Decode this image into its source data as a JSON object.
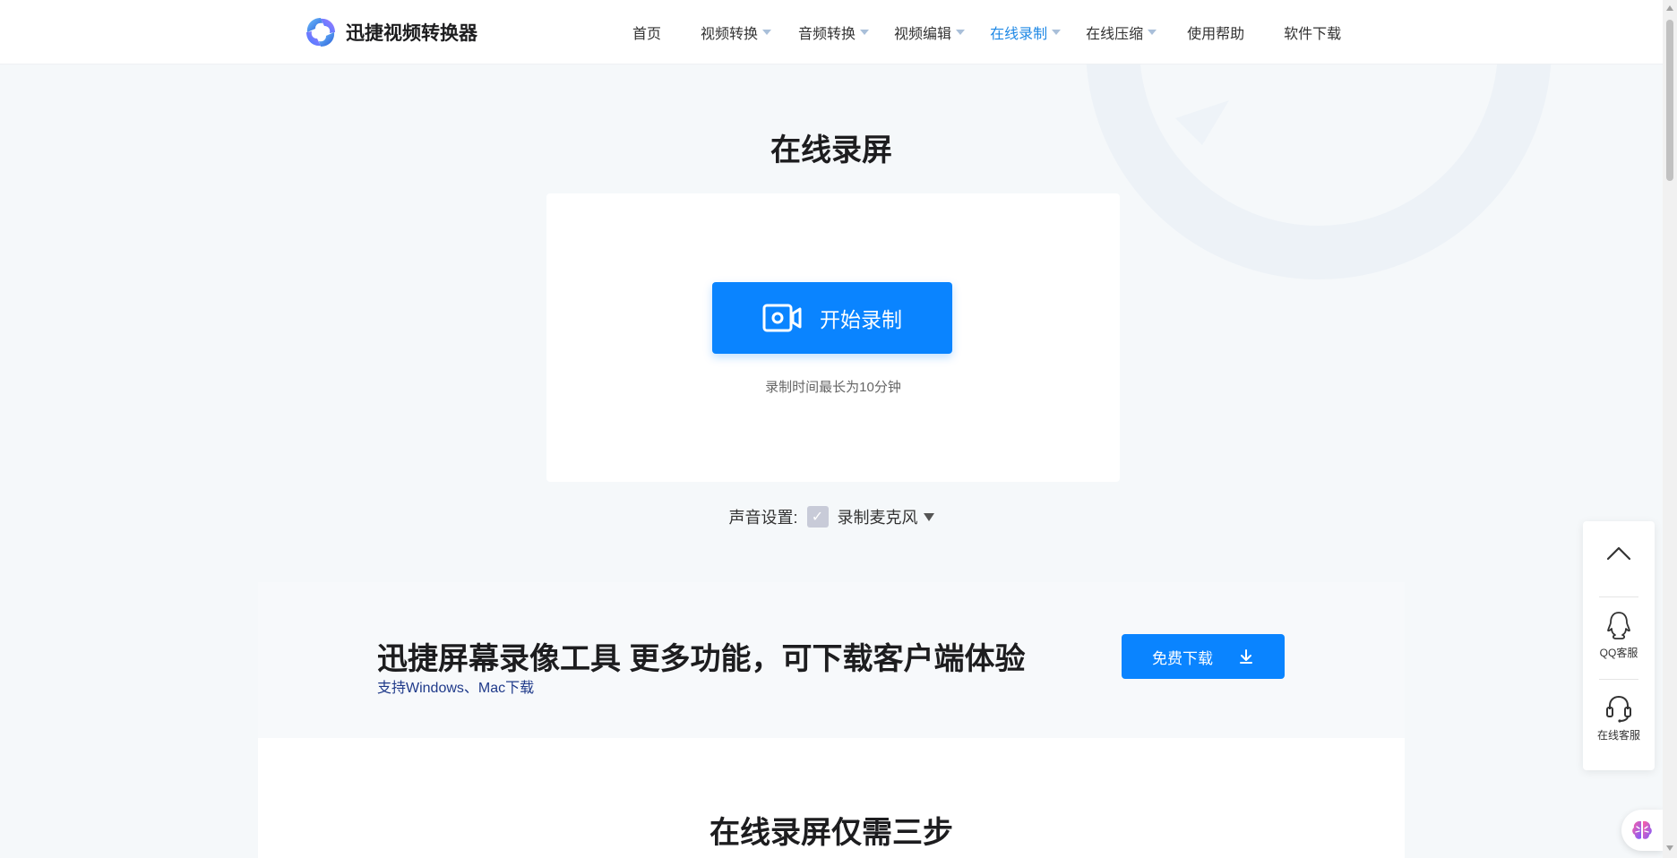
{
  "header": {
    "brand_name": "迅捷视频转换器",
    "nav": [
      {
        "label": "首页",
        "has_dropdown": false,
        "active": false
      },
      {
        "label": "视频转换",
        "has_dropdown": true,
        "active": false
      },
      {
        "label": "音频转换",
        "has_dropdown": true,
        "active": false
      },
      {
        "label": "视频编辑",
        "has_dropdown": true,
        "active": false
      },
      {
        "label": "在线录制",
        "has_dropdown": true,
        "active": true
      },
      {
        "label": "在线压缩",
        "has_dropdown": true,
        "active": false
      },
      {
        "label": "使用帮助",
        "has_dropdown": false,
        "active": false
      },
      {
        "label": "软件下载",
        "has_dropdown": false,
        "active": false
      }
    ]
  },
  "main": {
    "title": "在线录屏",
    "start_button_label": "开始录制",
    "record_hint": "录制时间最长为10分钟",
    "sound_settings_label": "声音设置:",
    "sound_option_label": "录制麦克风",
    "checkbox_checked": true
  },
  "promo": {
    "title": "迅捷屏幕录像工具 更多功能，可下载客户端体验",
    "subtitle": "支持Windows、Mac下载",
    "download_button_label": "免费下载"
  },
  "steps": {
    "title": "在线录屏仅需三步"
  },
  "side_panel": {
    "qq_label": "QQ客服",
    "online_label": "在线客服"
  },
  "colors": {
    "accent": "#0a84ff",
    "nav_active": "#1e88e5",
    "page_bg": "#f5f8fa"
  },
  "icons": [
    "logo-icon",
    "camera-icon",
    "download-icon",
    "chevron-up-icon",
    "qq-icon",
    "headset-icon",
    "brain-icon"
  ]
}
